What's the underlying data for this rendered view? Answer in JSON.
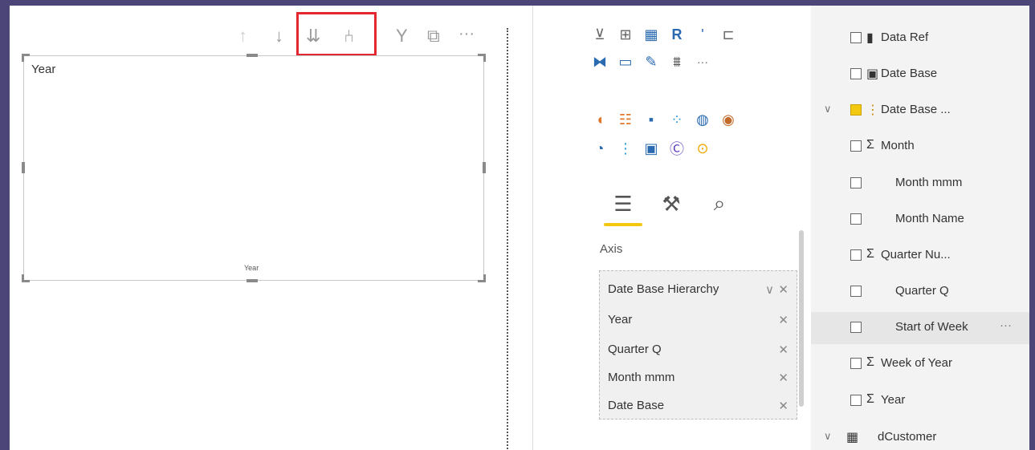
{
  "visual": {
    "field_title": "Year",
    "x_axis_label": "Year"
  },
  "toolbar": {
    "icons": [
      "arrow-up-icon",
      "arrow-down-icon",
      "expand-all-icon",
      "drill-down-icon",
      "filter-icon",
      "focus-mode-icon",
      "more-options-icon"
    ],
    "up": "↑",
    "down": "↓",
    "expand": "⇊",
    "drill": "⑃",
    "filter": "Y",
    "focus": "⧉",
    "more": "···"
  },
  "viz_pane": {
    "more_visuals": "···",
    "axis_label": "Axis",
    "axis_well": [
      {
        "label": "Date Base Hierarchy",
        "remove": "✕",
        "chevron": "∨"
      },
      {
        "label": "Year",
        "remove": "✕"
      },
      {
        "label": "Quarter Q",
        "remove": "✕"
      },
      {
        "label": "Month mmm",
        "remove": "✕"
      },
      {
        "label": "Date Base",
        "remove": "✕"
      }
    ]
  },
  "fields": {
    "items": [
      {
        "label": "Data Ref",
        "icon": "calculator-icon",
        "glyph": "▮",
        "checked": false
      },
      {
        "label": "Date Base",
        "icon": "date-table-icon",
        "glyph": "▣",
        "checked": false
      },
      {
        "label": "Date Base ...",
        "icon": "hierarchy-icon",
        "glyph": "⋮",
        "checked": true,
        "chevron": "∨"
      },
      {
        "label": "Month",
        "icon": "sigma-icon",
        "glyph": "Σ",
        "checked": false
      },
      {
        "label": "Month mmm",
        "icon": "",
        "glyph": "",
        "checked": false
      },
      {
        "label": "Month Name",
        "icon": "",
        "glyph": "",
        "checked": false
      },
      {
        "label": "Quarter Nu...",
        "icon": "sigma-icon",
        "glyph": "Σ",
        "checked": false
      },
      {
        "label": "Quarter Q",
        "icon": "",
        "glyph": "",
        "checked": false
      },
      {
        "label": "Start of Week",
        "icon": "",
        "glyph": "",
        "checked": false,
        "more": "···"
      },
      {
        "label": "Week of Year",
        "icon": "sigma-icon",
        "glyph": "Σ",
        "checked": false
      },
      {
        "label": "Year",
        "icon": "sigma-icon",
        "glyph": "Σ",
        "checked": false
      },
      {
        "label": "dCustomer",
        "icon": "table-icon",
        "glyph": "▦",
        "checked": false,
        "chevron": "∨"
      }
    ]
  },
  "colors": {
    "background": "#4b4578",
    "highlight": "#e3262f",
    "accent": "#f2c811"
  }
}
